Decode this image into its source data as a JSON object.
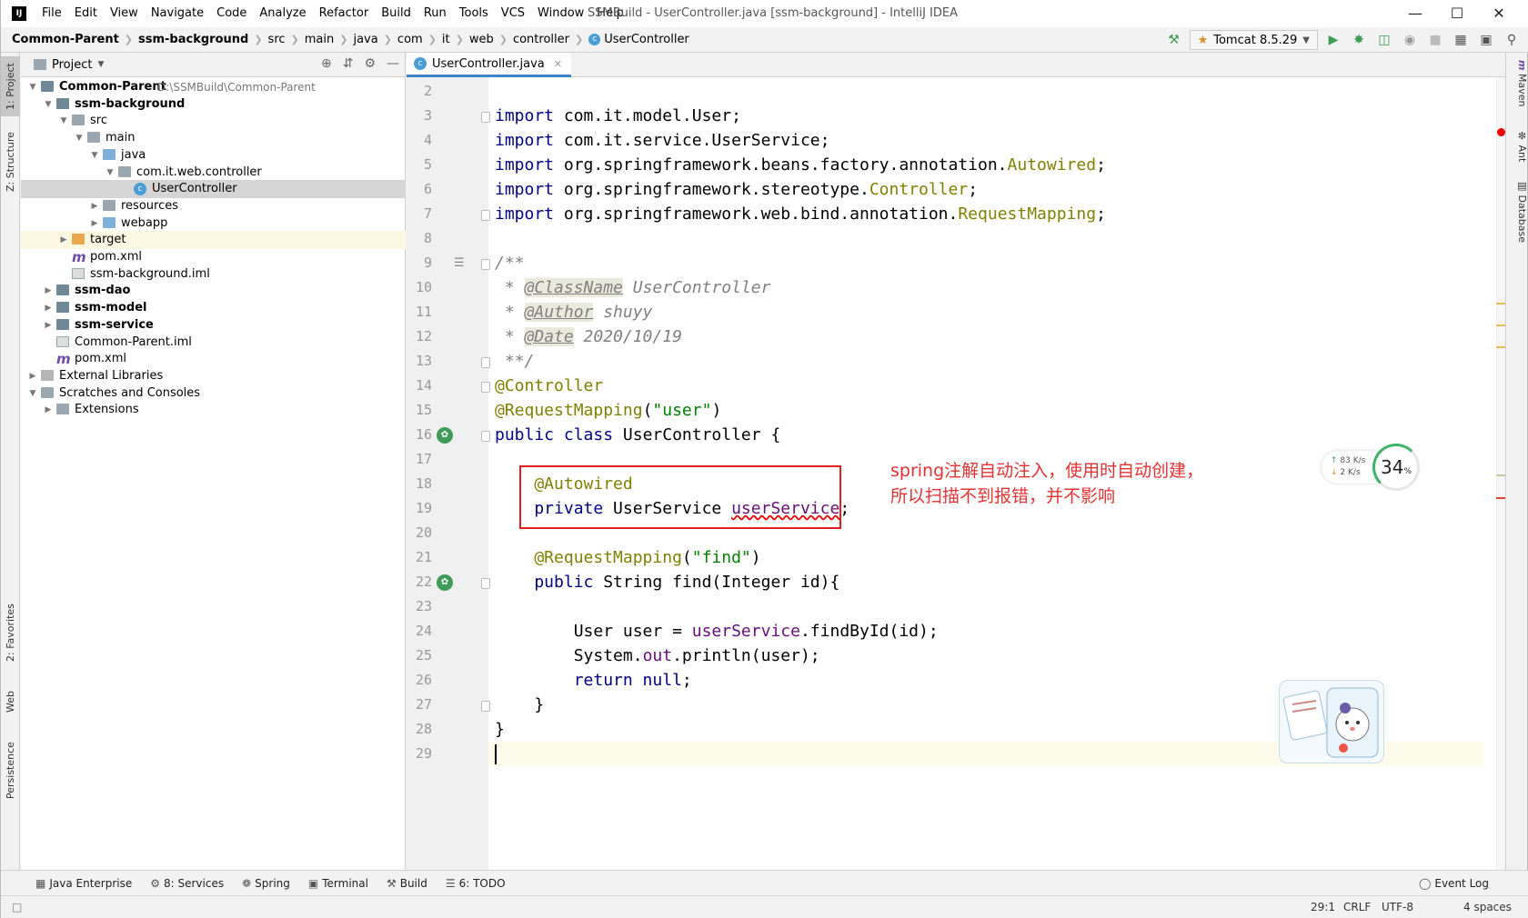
{
  "window": {
    "title": "SSMBuild - UserController.java [ssm-background] - IntelliJ IDEA",
    "menu": [
      "File",
      "Edit",
      "View",
      "Navigate",
      "Code",
      "Analyze",
      "Refactor",
      "Build",
      "Run",
      "Tools",
      "VCS",
      "Window",
      "Help"
    ],
    "app_icon_label": "IJ"
  },
  "breadcrumb": [
    "Common-Parent",
    "ssm-background",
    "src",
    "main",
    "java",
    "com",
    "it",
    "web",
    "controller",
    "UserController"
  ],
  "toolbar": {
    "run_config": "Tomcat 8.5.29"
  },
  "left_tool_tabs": [
    "1: Project",
    "Z: Structure",
    "2: Favorites",
    "Web",
    "Persistence"
  ],
  "right_tool_tabs": [
    "Maven",
    "Ant",
    "Database"
  ],
  "project_panel": {
    "title": "Project",
    "tree": [
      {
        "label": "Common-Parent",
        "extra": "D:\\SSMBuild\\Common-Parent",
        "depth": 0,
        "bold": true,
        "expanded": true,
        "icon": "module"
      },
      {
        "label": "ssm-background",
        "depth": 1,
        "bold": true,
        "expanded": true,
        "icon": "module"
      },
      {
        "label": "src",
        "depth": 2,
        "expanded": true,
        "icon": "folder"
      },
      {
        "label": "main",
        "depth": 3,
        "expanded": true,
        "icon": "folder"
      },
      {
        "label": "java",
        "depth": 4,
        "expanded": true,
        "icon": "folder-blue"
      },
      {
        "label": "com.it.web.controller",
        "depth": 5,
        "expanded": true,
        "icon": "package"
      },
      {
        "label": "UserController",
        "depth": 6,
        "icon": "class",
        "selected": true
      },
      {
        "label": "resources",
        "depth": 4,
        "expanded": false,
        "icon": "folder"
      },
      {
        "label": "webapp",
        "depth": 4,
        "expanded": false,
        "icon": "folder-web"
      },
      {
        "label": "target",
        "depth": 2,
        "expanded": false,
        "icon": "folder-orange",
        "excluded": true
      },
      {
        "label": "pom.xml",
        "depth": 2,
        "icon": "maven"
      },
      {
        "label": "ssm-background.iml",
        "depth": 2,
        "icon": "file"
      },
      {
        "label": "ssm-dao",
        "depth": 1,
        "bold": true,
        "expanded": false,
        "icon": "module"
      },
      {
        "label": "ssm-model",
        "depth": 1,
        "bold": true,
        "expanded": false,
        "icon": "module"
      },
      {
        "label": "ssm-service",
        "depth": 1,
        "bold": true,
        "expanded": false,
        "icon": "module"
      },
      {
        "label": "Common-Parent.iml",
        "depth": 1,
        "icon": "file"
      },
      {
        "label": "pom.xml",
        "depth": 1,
        "icon": "maven"
      },
      {
        "label": "External Libraries",
        "depth": 0,
        "expanded": false,
        "icon": "library"
      },
      {
        "label": "Scratches and Consoles",
        "depth": 0,
        "expanded": true,
        "icon": "scratch"
      },
      {
        "label": "Extensions",
        "depth": 1,
        "expanded": false,
        "icon": "folder"
      }
    ]
  },
  "editor": {
    "tab": "UserController.java",
    "line_numbers": [
      "2",
      "3",
      "4",
      "5",
      "6",
      "7",
      "8",
      "9",
      "10",
      "11",
      "12",
      "13",
      "14",
      "15",
      "16",
      "17",
      "18",
      "19",
      "20",
      "21",
      "22",
      "23",
      "24",
      "25",
      "26",
      "27",
      "28",
      "29"
    ],
    "lines": [
      [],
      [
        {
          "t": "import ",
          "c": "kw"
        },
        {
          "t": "com.it.model.User;",
          "c": "plain"
        }
      ],
      [
        {
          "t": "import ",
          "c": "kw"
        },
        {
          "t": "com.it.service.UserService;",
          "c": "plain"
        }
      ],
      [
        {
          "t": "import ",
          "c": "kw"
        },
        {
          "t": "org.springframework.beans.factory.annotation.",
          "c": "plain"
        },
        {
          "t": "Autowired",
          "c": "ann"
        },
        {
          "t": ";",
          "c": "plain"
        }
      ],
      [
        {
          "t": "import ",
          "c": "kw"
        },
        {
          "t": "org.springframework.stereotype.",
          "c": "plain"
        },
        {
          "t": "Controller",
          "c": "ann"
        },
        {
          "t": ";",
          "c": "plain"
        }
      ],
      [
        {
          "t": "import ",
          "c": "kw"
        },
        {
          "t": "org.springframework.web.bind.annotation.",
          "c": "plain"
        },
        {
          "t": "RequestMapping",
          "c": "ann"
        },
        {
          "t": ";",
          "c": "plain"
        }
      ],
      [],
      [
        {
          "t": "/**",
          "c": "cmt"
        }
      ],
      [
        {
          "t": " * ",
          "c": "cmt"
        },
        {
          "t": "@ClassName",
          "c": "doctag"
        },
        {
          "t": " UserController",
          "c": "cmt"
        }
      ],
      [
        {
          "t": " * ",
          "c": "cmt"
        },
        {
          "t": "@Author",
          "c": "doctag"
        },
        {
          "t": " shuyy",
          "c": "cmt"
        }
      ],
      [
        {
          "t": " * ",
          "c": "cmt"
        },
        {
          "t": "@Date",
          "c": "doctag"
        },
        {
          "t": " 2020/10/19",
          "c": "cmt"
        }
      ],
      [
        {
          "t": " **/",
          "c": "cmt"
        }
      ],
      [
        {
          "t": "@Controller",
          "c": "ann"
        }
      ],
      [
        {
          "t": "@RequestMapping",
          "c": "ann"
        },
        {
          "t": "(",
          "c": "plain"
        },
        {
          "t": "\"user\"",
          "c": "str"
        },
        {
          "t": ")",
          "c": "plain"
        }
      ],
      [
        {
          "t": "public class ",
          "c": "kw"
        },
        {
          "t": "UserController {",
          "c": "plain"
        }
      ],
      [],
      [
        {
          "t": "    @Autowired",
          "c": "ann"
        }
      ],
      [
        {
          "t": "    private ",
          "c": "kw"
        },
        {
          "t": "UserService ",
          "c": "plain"
        },
        {
          "t": "userService",
          "c": "fld err"
        },
        {
          "t": ";",
          "c": "plain"
        }
      ],
      [],
      [
        {
          "t": "    @RequestMapping",
          "c": "ann"
        },
        {
          "t": "(",
          "c": "plain"
        },
        {
          "t": "\"find\"",
          "c": "str"
        },
        {
          "t": ")",
          "c": "plain"
        }
      ],
      [
        {
          "t": "    public ",
          "c": "kw"
        },
        {
          "t": "String find(Integer id){",
          "c": "plain"
        }
      ],
      [],
      [
        {
          "t": "        User user = ",
          "c": "plain"
        },
        {
          "t": "userService",
          "c": "fld"
        },
        {
          "t": ".findById(id);",
          "c": "plain"
        }
      ],
      [
        {
          "t": "        System.",
          "c": "plain"
        },
        {
          "t": "out",
          "c": "fld"
        },
        {
          "t": ".println(user);",
          "c": "plain"
        }
      ],
      [
        {
          "t": "        return null",
          "c": "kw"
        },
        {
          "t": ";",
          "c": "plain"
        }
      ],
      [
        {
          "t": "    }",
          "c": "plain"
        }
      ],
      [
        {
          "t": "}",
          "c": "plain"
        }
      ],
      []
    ],
    "annotation_note": "spring注解自动注入，使用时自动创建，\n所以扫描不到报错，并不影响",
    "network_widget": {
      "upload": "83",
      "download": "2",
      "unit": "K/s",
      "percent": "34",
      "percent_unit": "%"
    }
  },
  "bottom_tools": [
    {
      "label": "Java Enterprise",
      "icon": "java-enterprise-icon"
    },
    {
      "label": "8: Services",
      "icon": "services-icon"
    },
    {
      "label": "Spring",
      "icon": "spring-icon"
    },
    {
      "label": "Terminal",
      "icon": "terminal-icon"
    },
    {
      "label": "Build",
      "icon": "build-icon"
    },
    {
      "label": "6: TODO",
      "icon": "todo-icon"
    }
  ],
  "event_log": "Event Log",
  "status": {
    "position": "29:1",
    "line_sep": "CRLF",
    "encoding": "UTF-8",
    "indent": "4 spaces"
  },
  "colors": {
    "keyword": "#000080",
    "annotation": "#808000",
    "string": "#008000",
    "comment": "#808080",
    "field": "#660e7a",
    "note": "#e53232",
    "selection": "#d5d5d5"
  }
}
